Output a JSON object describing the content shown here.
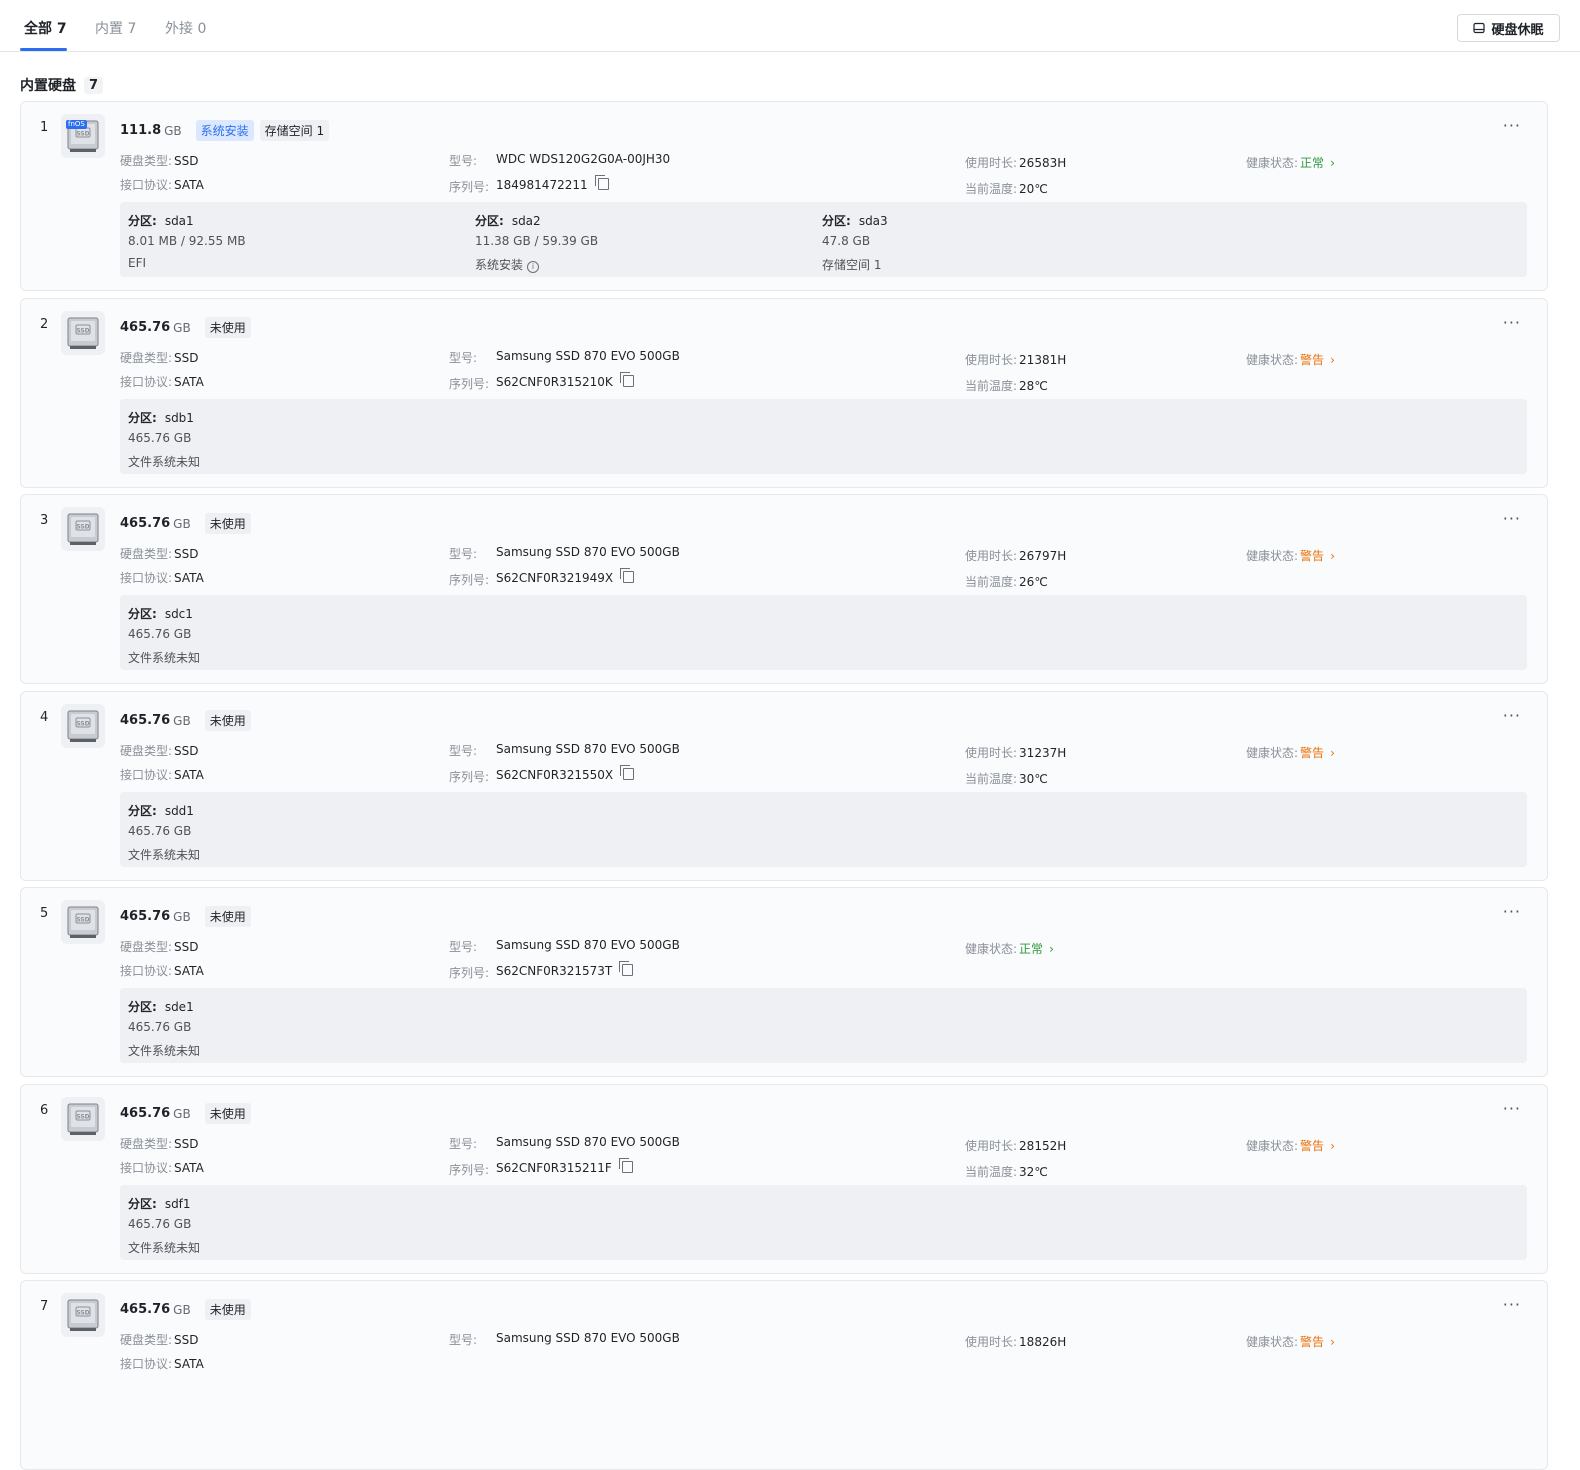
{
  "tabs": [
    {
      "label": "全部 7",
      "active": true
    },
    {
      "label": "内置 7",
      "active": false
    },
    {
      "label": "外接 0",
      "active": false
    }
  ],
  "sleep_button": "硬盘休眠",
  "section": {
    "title": "内置硬盘",
    "count": "7"
  },
  "labels": {
    "type": "硬盘类型:",
    "interface": "接口协议:",
    "model": "型号:",
    "serial": "序列号:",
    "usage": "使用时长:",
    "temp": "当前温度:",
    "health": "健康状态:",
    "partition": "分区:"
  },
  "colors": {
    "accent": "#2b6ff0",
    "ok": "#2e9a3e",
    "warn": "#e8730c"
  },
  "disks": [
    {
      "index": "1",
      "capacity": "111.8",
      "unit": "GB",
      "badges": [
        "系统安装",
        "存储空间 1"
      ],
      "fnos": "fnOS",
      "type": "SSD",
      "interface": "SATA",
      "model": "WDC WDS120G2G0A-00JH30",
      "serial": "184981472211",
      "usage": "26583H",
      "temp": "20℃",
      "health": "正常",
      "partitions": [
        {
          "name": "sda1",
          "size": "8.01 MB / 92.55 MB",
          "fs": "EFI"
        },
        {
          "name": "sda2",
          "size": "11.38 GB / 59.39 GB",
          "fs": "系统安装"
        },
        {
          "name": "sda3",
          "size": "47.8 GB",
          "fs": "存储空间 1"
        }
      ]
    },
    {
      "index": "2",
      "capacity": "465.76",
      "unit": "GB",
      "badges": [
        "未使用"
      ],
      "type": "SSD",
      "interface": "SATA",
      "model": "Samsung SSD 870 EVO 500GB",
      "serial": "S62CNF0R315210K",
      "usage": "21381H",
      "temp": "28℃",
      "health": "警告",
      "partitions": [
        {
          "name": "sdb1",
          "size": "465.76 GB",
          "fs": "文件系统未知"
        }
      ]
    },
    {
      "index": "3",
      "capacity": "465.76",
      "unit": "GB",
      "badges": [
        "未使用"
      ],
      "type": "SSD",
      "interface": "SATA",
      "model": "Samsung SSD 870 EVO 500GB",
      "serial": "S62CNF0R321949X",
      "usage": "26797H",
      "temp": "26℃",
      "health": "警告",
      "partitions": [
        {
          "name": "sdc1",
          "size": "465.76 GB",
          "fs": "文件系统未知"
        }
      ]
    },
    {
      "index": "4",
      "capacity": "465.76",
      "unit": "GB",
      "badges": [
        "未使用"
      ],
      "type": "SSD",
      "interface": "SATA",
      "model": "Samsung SSD 870 EVO 500GB",
      "serial": "S62CNF0R321550X",
      "usage": "31237H",
      "temp": "30℃",
      "health": "警告",
      "partitions": [
        {
          "name": "sdd1",
          "size": "465.76 GB",
          "fs": "文件系统未知"
        }
      ]
    },
    {
      "index": "5",
      "capacity": "465.76",
      "unit": "GB",
      "badges": [
        "未使用"
      ],
      "type": "SSD",
      "interface": "SATA",
      "model": "Samsung SSD 870 EVO 500GB",
      "serial": "S62CNF0R321573T",
      "health": "正常",
      "partitions": [
        {
          "name": "sde1",
          "size": "465.76 GB",
          "fs": "文件系统未知"
        }
      ]
    },
    {
      "index": "6",
      "capacity": "465.76",
      "unit": "GB",
      "badges": [
        "未使用"
      ],
      "type": "SSD",
      "interface": "SATA",
      "model": "Samsung SSD 870 EVO 500GB",
      "serial": "S62CNF0R315211F",
      "usage": "28152H",
      "temp": "32℃",
      "health": "警告",
      "partitions": [
        {
          "name": "sdf1",
          "size": "465.76 GB",
          "fs": "文件系统未知"
        }
      ]
    },
    {
      "index": "7",
      "capacity": "465.76",
      "unit": "GB",
      "badges": [
        "未使用"
      ],
      "type": "SSD",
      "interface": "SATA",
      "model": "Samsung SSD 870 EVO 500GB",
      "usage": "18826H",
      "health": "警告",
      "partitions": []
    }
  ]
}
